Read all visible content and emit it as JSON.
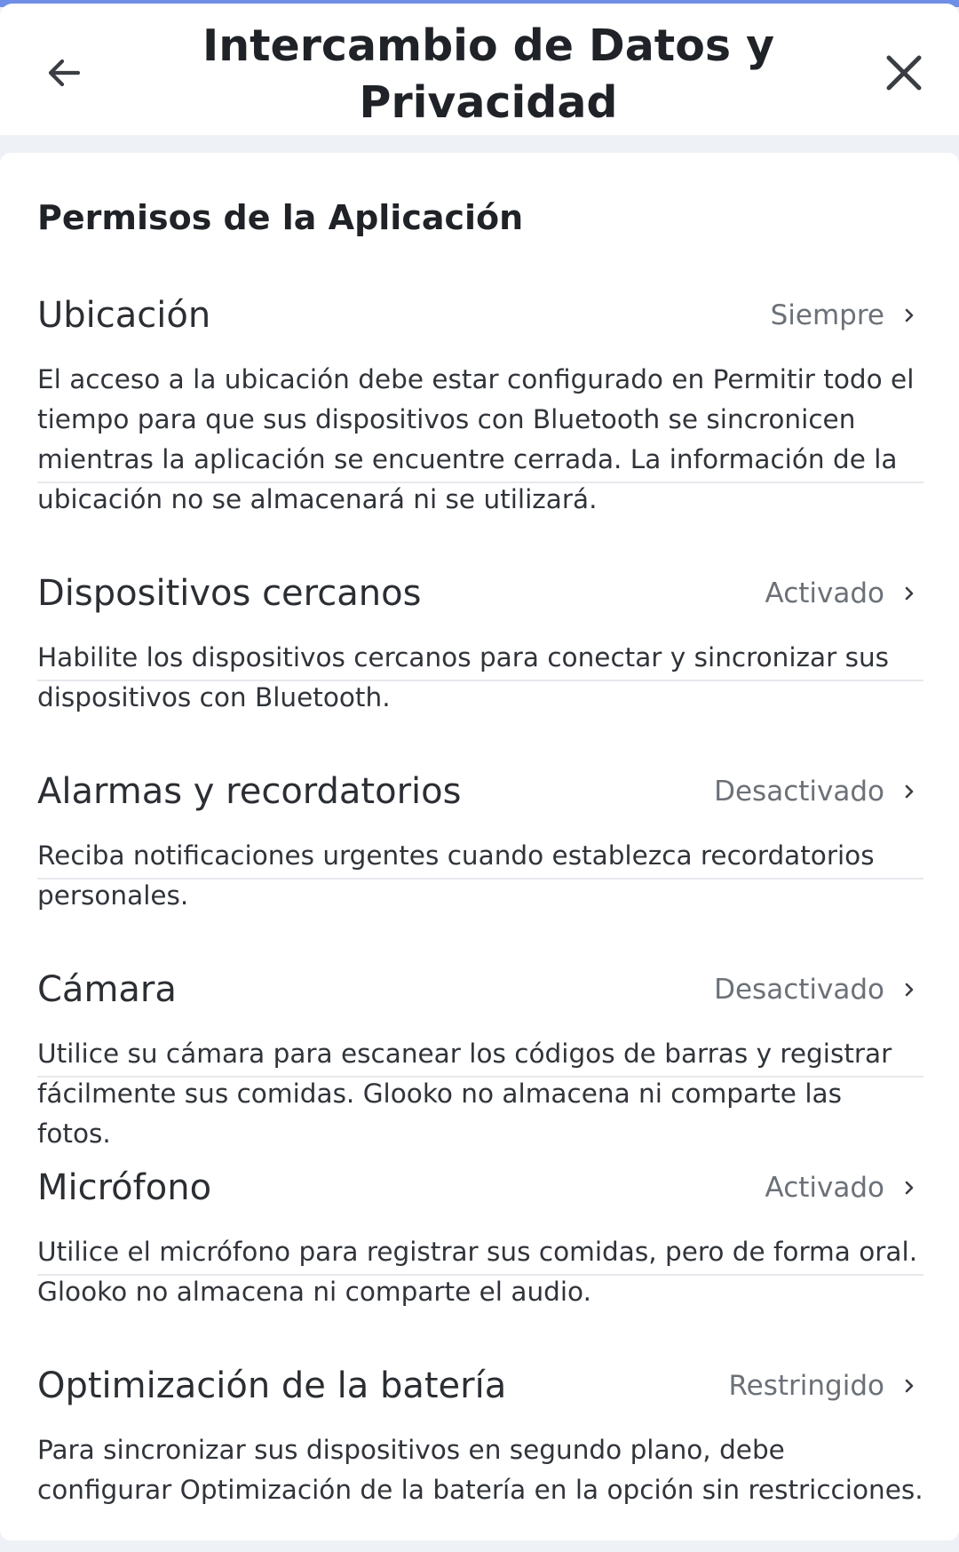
{
  "header": {
    "title_line1": "Intercambio de Datos y",
    "title_line2": "Privacidad",
    "back_icon": "arrow-left-icon",
    "close_icon": "close-icon"
  },
  "section": {
    "title": "Permisos de la Aplicación"
  },
  "permissions": [
    {
      "label": "Ubicación",
      "status": "Siempre",
      "description": "El acceso a la ubicación debe estar configurado en Permitir todo el tiempo para que sus dispositivos con Bluetooth se sincronicen mientras la aplicación se encuentre cerrada. La información de la ubicación no se almacenará ni se utilizará."
    },
    {
      "label": "Dispositivos cercanos",
      "status": "Activado",
      "description": "Habilite los dispositivos cercanos para conectar y sincronizar sus dispositivos con Bluetooth."
    },
    {
      "label": "Alarmas y recordatorios",
      "status": "Desactivado",
      "description": "Reciba notificaciones urgentes cuando establezca recordatorios personales."
    },
    {
      "label": "Cámara",
      "status": "Desactivado",
      "description": "Utilice su cámara para escanear los códigos de barras y registrar fácilmente sus comidas. Glooko no almacena ni comparte las fotos."
    },
    {
      "label": "Micrófono",
      "status": "Activado",
      "description": "Utilice el micrófono para registrar sus comidas, pero de forma oral. Glooko no almacena ni comparte el audio."
    },
    {
      "label": "Optimización de la batería",
      "status": "Restringido",
      "description": "Para sincronizar sus dispositivos en segundo plano, debe configurar Optimización de la batería en la opción sin restricciones."
    }
  ],
  "colors": {
    "top_strip": "#6f8fe6",
    "background": "#eef1f6",
    "text_primary": "#2b2e33",
    "text_secondary": "#6c7178",
    "divider": "#e6e8ec"
  }
}
